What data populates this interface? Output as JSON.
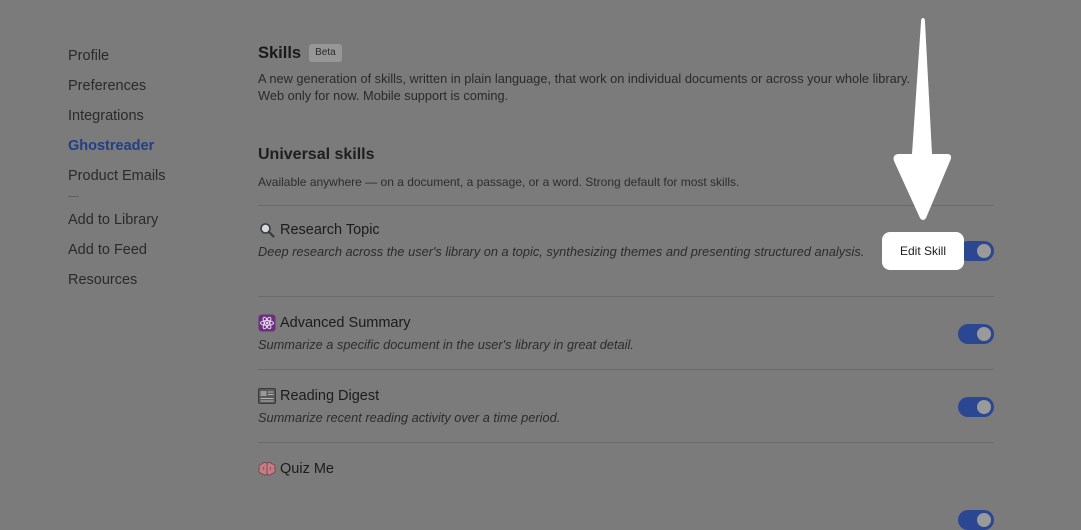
{
  "sidebar": {
    "items": [
      {
        "label": "Profile",
        "active": false
      },
      {
        "label": "Preferences",
        "active": false
      },
      {
        "label": "Integrations",
        "active": false
      },
      {
        "label": "Ghostreader",
        "active": true
      },
      {
        "label": "Product Emails",
        "active": false
      }
    ],
    "secondary_items": [
      {
        "label": "Add to Library"
      },
      {
        "label": "Add to Feed"
      },
      {
        "label": "Resources"
      }
    ]
  },
  "header": {
    "title": "Skills",
    "badge": "Beta",
    "description_line1": "A new generation of skills, written in plain language, that work on individual documents or across your whole library.",
    "description_line2": "Web only for now. Mobile support is coming."
  },
  "universal": {
    "title": "Universal skills",
    "subtitle": "Available anywhere — on a document, a passage, or a word. Strong default for most skills."
  },
  "skills": [
    {
      "icon": "magnifying-glass-icon",
      "emoji": "🔍",
      "name": "Research Topic",
      "description": "Deep research across the user's library on a topic, synthesizing themes and presenting structured analysis.",
      "enabled": true
    },
    {
      "icon": "atom-icon",
      "emoji": "⚛",
      "name": "Advanced Summary",
      "description": "Summarize a specific document in the user's library in great detail.",
      "enabled": true
    },
    {
      "icon": "newspaper-icon",
      "emoji": "📰",
      "name": "Reading Digest",
      "description": "Summarize recent reading activity over a time period.",
      "enabled": true
    },
    {
      "icon": "brain-icon",
      "emoji": "🧠",
      "name": "Quiz Me",
      "description": "",
      "enabled": true
    }
  ],
  "tooltip": {
    "label": "Edit Skill"
  },
  "colors": {
    "accent": "#1f3f87",
    "toggle_on": "#2b4791",
    "overlay": "#7b7b7b"
  }
}
